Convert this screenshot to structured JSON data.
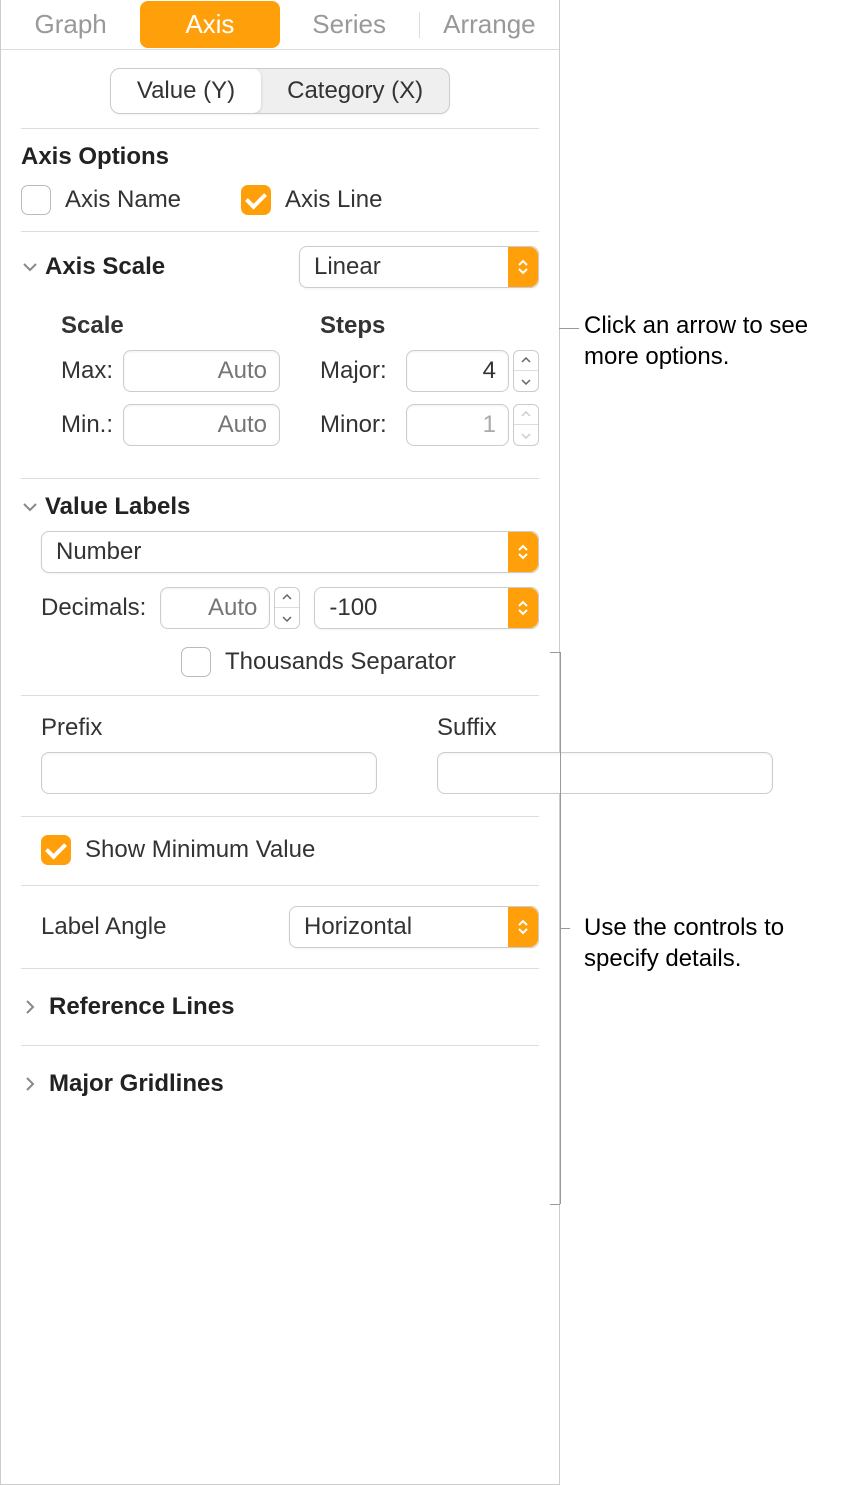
{
  "tabs": {
    "graph": "Graph",
    "axis": "Axis",
    "series": "Series",
    "arrange": "Arrange"
  },
  "segmented": {
    "valueY": "Value (Y)",
    "categoryX": "Category (X)"
  },
  "axisOptions": {
    "title": "Axis Options",
    "axisName": "Axis Name",
    "axisLine": "Axis Line"
  },
  "axisScale": {
    "title": "Axis Scale",
    "selected": "Linear",
    "scaleTitle": "Scale",
    "stepsTitle": "Steps",
    "maxLabel": "Max:",
    "minLabel": "Min.:",
    "majorLabel": "Major:",
    "minorLabel": "Minor:",
    "autoPlaceholder": "Auto",
    "majorValue": "4",
    "minorValue": "1"
  },
  "valueLabels": {
    "title": "Value Labels",
    "format": "Number",
    "decimalsLabel": "Decimals:",
    "decimalsPlaceholder": "Auto",
    "negFormat": "-100",
    "thousands": "Thousands Separator",
    "prefixLabel": "Prefix",
    "suffixLabel": "Suffix",
    "showMinimum": "Show Minimum Value",
    "labelAngleLabel": "Label Angle",
    "labelAngleValue": "Horizontal"
  },
  "referenceLines": "Reference Lines",
  "majorGridlines": "Major Gridlines",
  "annotations": {
    "a1": "Click an arrow to see more options.",
    "a2": "Use the controls to specify details."
  }
}
